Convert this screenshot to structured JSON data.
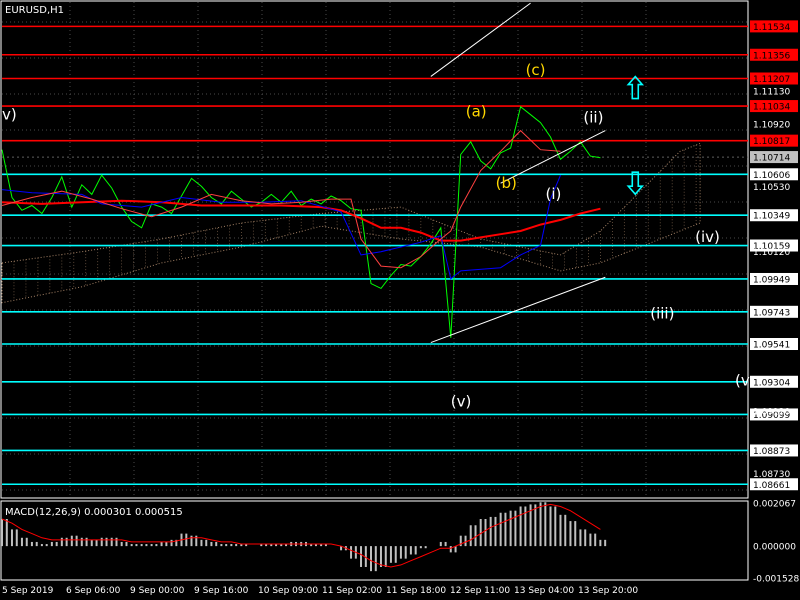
{
  "chart_data": {
    "type": "line",
    "title": "EURUSD,H1",
    "symbol": "EURUSD",
    "timeframe": "H1",
    "ylim": [
      1.08581,
      1.11687
    ],
    "grid": true,
    "price_ticks": [
      "1.11130",
      "1.10920",
      "1.10530",
      "1.10120",
      "1.09120",
      "1.08730"
    ],
    "x_ticks": [
      "5 Sep 2019",
      "6 Sep 06:00",
      "9 Sep 00:00",
      "9 Sep 16:00",
      "10 Sep 09:00",
      "11 Sep 02:00",
      "11 Sep 18:00",
      "12 Sep 11:00",
      "13 Sep 04:00",
      "13 Sep 20:00"
    ],
    "levels": [
      {
        "label": "1.11534",
        "value": 1.11534,
        "color": "#ff0000"
      },
      {
        "label": "1.11356",
        "value": 1.11356,
        "color": "#ff0000"
      },
      {
        "label": "1.11207",
        "value": 1.11207,
        "color": "#ff0000"
      },
      {
        "label": "1.11034",
        "value": 1.11034,
        "color": "#ff0000"
      },
      {
        "label": "1.10817",
        "value": 1.10817,
        "color": "#ff0000"
      },
      {
        "label": "1.10714",
        "value": 1.10714,
        "color": "#c0c0c0"
      },
      {
        "label": "1.10606",
        "value": 1.10606,
        "color": "#00ffff"
      },
      {
        "label": "1.10349",
        "value": 1.10349,
        "color": "#00ffff"
      },
      {
        "label": "1.10159",
        "value": 1.10159,
        "color": "#00ffff"
      },
      {
        "label": "1.09949",
        "value": 1.09949,
        "color": "#00ffff"
      },
      {
        "label": "1.09743",
        "value": 1.09743,
        "color": "#00ffff"
      },
      {
        "label": "1.09541",
        "value": 1.09541,
        "color": "#00ffff"
      },
      {
        "label": "1.09304",
        "value": 1.09304,
        "color": "#00ffff"
      },
      {
        "label": "1.09099",
        "value": 1.09099,
        "color": "#00ffff"
      },
      {
        "label": "1.08873",
        "value": 1.08873,
        "color": "#00ffff"
      },
      {
        "label": "1.08661",
        "value": 1.08661,
        "color": "#00ffff"
      }
    ],
    "wave_labels": [
      {
        "text": "v)",
        "time": 0.0,
        "price": 1.1095,
        "color": "#ffffff"
      },
      {
        "text": "(a)",
        "time": 46.5,
        "price": 1.1097,
        "color": "#ffd700"
      },
      {
        "text": "(b)",
        "time": 49.5,
        "price": 1.1052,
        "color": "#ffd700"
      },
      {
        "text": "(c)",
        "time": 52.5,
        "price": 1.1123,
        "color": "#ffd700"
      },
      {
        "text": "(ii)",
        "time": 58.3,
        "price": 1.1093,
        "color": "#ffffff"
      },
      {
        "text": "(i)",
        "time": 54.5,
        "price": 1.1045,
        "color": "#ffffff"
      },
      {
        "text": "(iv)",
        "time": 69.5,
        "price": 1.1018,
        "color": "#ffffff"
      },
      {
        "text": "(iii)",
        "time": 65.0,
        "price": 1.097,
        "color": "#ffffff"
      },
      {
        "text": "(v)",
        "time": 45.0,
        "price": 1.0915,
        "color": "#ffffff"
      },
      {
        "text": "(v",
        "time": 73.5,
        "price": 1.0928,
        "color": "#ffffff"
      }
    ],
    "channel": [
      {
        "from": [
          43.0,
          1.1122
        ],
        "to": [
          53.0,
          1.1168
        ]
      },
      {
        "from": [
          43.0,
          1.0955
        ],
        "to": [
          60.5,
          1.0996
        ]
      },
      {
        "from": [
          50.0,
          1.1055
        ],
        "to": [
          60.5,
          1.1088
        ]
      }
    ],
    "arrows": [
      {
        "direction": "up",
        "time": 63.5,
        "price": 1.1115,
        "color": "#00ffff"
      },
      {
        "direction": "down",
        "time": 63.5,
        "price": 1.1055,
        "color": "#00ffff"
      }
    ],
    "series": [
      {
        "name": "",
        "color": "#00ff00",
        "x": [
          0,
          1,
          2,
          3,
          4,
          5,
          6,
          7,
          8,
          9,
          10,
          11,
          12,
          13,
          14,
          15,
          16,
          17,
          18,
          19,
          20,
          21,
          22,
          23,
          24,
          25,
          26,
          27,
          28,
          29,
          30,
          31,
          32,
          33,
          34,
          35,
          36,
          37,
          38,
          39,
          40,
          41,
          42,
          43,
          44,
          45,
          46,
          47,
          48,
          49,
          50,
          51,
          52,
          53,
          54,
          55,
          56,
          57,
          58,
          59,
          60
        ],
        "y": [
          1.1076,
          1.1046,
          1.1038,
          1.1041,
          1.1036,
          1.1046,
          1.1059,
          1.104,
          1.1054,
          1.1048,
          1.106,
          1.1052,
          1.104,
          1.1031,
          1.1027,
          1.1042,
          1.104,
          1.1036,
          1.1047,
          1.1058,
          1.1053,
          1.1046,
          1.1042,
          1.105,
          1.1045,
          1.104,
          1.1043,
          1.1048,
          1.1043,
          1.105,
          1.1041,
          1.1045,
          1.1042,
          1.1047,
          1.1044,
          1.1039,
          1.1038,
          1.0992,
          1.0989,
          1.0997,
          1.1004,
          1.1003,
          1.1009,
          1.1017,
          1.1027,
          1.0958,
          1.1073,
          1.1081,
          1.1069,
          1.1064,
          1.1074,
          1.1077,
          1.1103,
          1.1098,
          1.1093,
          1.1084,
          1.107,
          1.1075,
          1.1081,
          1.1072,
          1.1071
        ]
      },
      {
        "name": "",
        "color": "#ff0000",
        "x": [
          0,
          4,
          8,
          12,
          16,
          20,
          24,
          28,
          32,
          34,
          36,
          38,
          40,
          42,
          44,
          46,
          48,
          50,
          52,
          54,
          56,
          58,
          60
        ],
        "y": [
          1.1043,
          1.1042,
          1.1043,
          1.1044,
          1.1043,
          1.1041,
          1.1041,
          1.1041,
          1.104,
          1.1038,
          1.1033,
          1.1027,
          1.1027,
          1.1024,
          1.1019,
          1.1019,
          1.1021,
          1.1023,
          1.1025,
          1.1029,
          1.1032,
          1.1036,
          1.1039
        ]
      },
      {
        "name": "",
        "color": "#0000ff",
        "x": [
          0,
          3,
          8,
          10,
          14,
          18,
          22,
          26,
          30,
          34,
          36,
          38,
          40,
          42,
          44,
          45,
          46,
          50,
          52,
          54,
          55,
          56
        ],
        "y": [
          1.1051,
          1.1049,
          1.1048,
          1.1042,
          1.104,
          1.1046,
          1.1043,
          1.1043,
          1.1044,
          1.1037,
          1.101,
          1.1012,
          1.1015,
          1.1018,
          1.1022,
          1.0995,
          1.1,
          1.1002,
          1.101,
          1.1016,
          1.1045,
          1.106
        ]
      },
      {
        "name": "",
        "color": "#ff4040",
        "x": [
          0,
          3,
          6,
          9,
          12,
          15,
          18,
          21,
          24,
          27,
          30,
          33,
          35,
          36,
          38,
          40,
          42,
          44,
          45,
          46,
          48,
          50,
          52,
          54,
          56
        ],
        "y": [
          1.1041,
          1.1046,
          1.105,
          1.1045,
          1.1039,
          1.1034,
          1.104,
          1.1048,
          1.1044,
          1.1042,
          1.1043,
          1.1045,
          1.1045,
          1.102,
          1.1003,
          1.1002,
          1.1009,
          1.102,
          1.1025,
          1.104,
          1.1063,
          1.1075,
          1.1088,
          1.1076,
          1.1075
        ]
      }
    ],
    "macd": {
      "label": "MACD(12,26,9) 0.000301 0.000515",
      "ylim": [
        -0.001528,
        0.002067
      ],
      "ticks": [
        "0.002067",
        "0.000000",
        "-0.001528"
      ],
      "hist_x": [
        0,
        1,
        2,
        3,
        4,
        5,
        6,
        7,
        8,
        9,
        10,
        11,
        12,
        13,
        14,
        15,
        16,
        17,
        18,
        19,
        20,
        21,
        22,
        23,
        24,
        25,
        26,
        27,
        28,
        29,
        30,
        31,
        32,
        33,
        34,
        35,
        36,
        37,
        38,
        39,
        40,
        41,
        42,
        43,
        44,
        45,
        46,
        47,
        48,
        49,
        50,
        51,
        52,
        53,
        54,
        55,
        56,
        57,
        58,
        59,
        60
      ],
      "hist": [
        0.0013,
        0.0008,
        0.0004,
        0.0002,
        0.0001,
        0.0002,
        0.0004,
        0.0005,
        0.0004,
        0.0003,
        0.0004,
        0.0004,
        0.0002,
        0.0001,
        0.0001,
        0.0001,
        0.0002,
        0.0003,
        0.0006,
        0.0005,
        0.0003,
        0.0002,
        0.0001,
        0.0001,
        0.0001,
        0.0,
        0.0001,
        0.0001,
        0.0001,
        0.0002,
        0.0002,
        0.0001,
        0.0001,
        0.0,
        -0.0002,
        -0.0006,
        -0.001,
        -0.0012,
        -0.001,
        -0.0008,
        -0.0006,
        -0.0004,
        -0.0001,
        0.0,
        0.0002,
        -0.0003,
        0.0005,
        0.001,
        0.0013,
        0.0014,
        0.0016,
        0.0017,
        0.0019,
        0.002,
        0.0021,
        0.0019,
        0.0015,
        0.0012,
        0.0008,
        0.0006,
        0.0003
      ],
      "signal": [
        0.0013,
        0.0011,
        0.0008,
        0.0006,
        0.0004,
        0.0003,
        0.0003,
        0.0003,
        0.0003,
        0.0003,
        0.0003,
        0.0003,
        0.0003,
        0.0002,
        0.0002,
        0.0002,
        0.0002,
        0.0002,
        0.0003,
        0.0004,
        0.0004,
        0.0003,
        0.0002,
        0.0002,
        0.0001,
        0.0001,
        0.0001,
        0.0001,
        0.0001,
        0.0001,
        0.0001,
        0.0001,
        0.0001,
        0.0001,
        0.0,
        -0.0002,
        -0.0004,
        -0.0007,
        -0.0009,
        -0.001,
        -0.0009,
        -0.0007,
        -0.0005,
        -0.0003,
        -0.0001,
        -0.0001,
        0.0001,
        0.0003,
        0.0006,
        0.0009,
        0.0011,
        0.0013,
        0.0015,
        0.0017,
        0.0019,
        0.002,
        0.0019,
        0.0017,
        0.0014,
        0.0011,
        0.0008
      ]
    }
  }
}
